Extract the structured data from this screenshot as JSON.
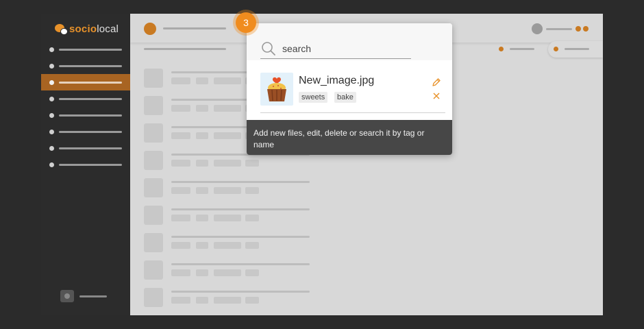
{
  "brand": {
    "name_accent": "socio",
    "name_rest": "local",
    "accent_color": "#e8922a"
  },
  "sidebar": {
    "item_count": 8,
    "active_index": 2
  },
  "file_rows": {
    "count": 10
  },
  "step_badge": {
    "number": "3"
  },
  "popup": {
    "search": {
      "value": "search",
      "placeholder": "search"
    },
    "file": {
      "name": "New_image.jpg",
      "tags": [
        "sweets",
        "bake"
      ],
      "thumbnail": "cupcake-icon"
    },
    "hint": "Add new files, edit, delete or search it by tag or name"
  },
  "icons": {
    "search": "search-icon",
    "edit": "pencil-icon",
    "delete": "close-icon"
  }
}
